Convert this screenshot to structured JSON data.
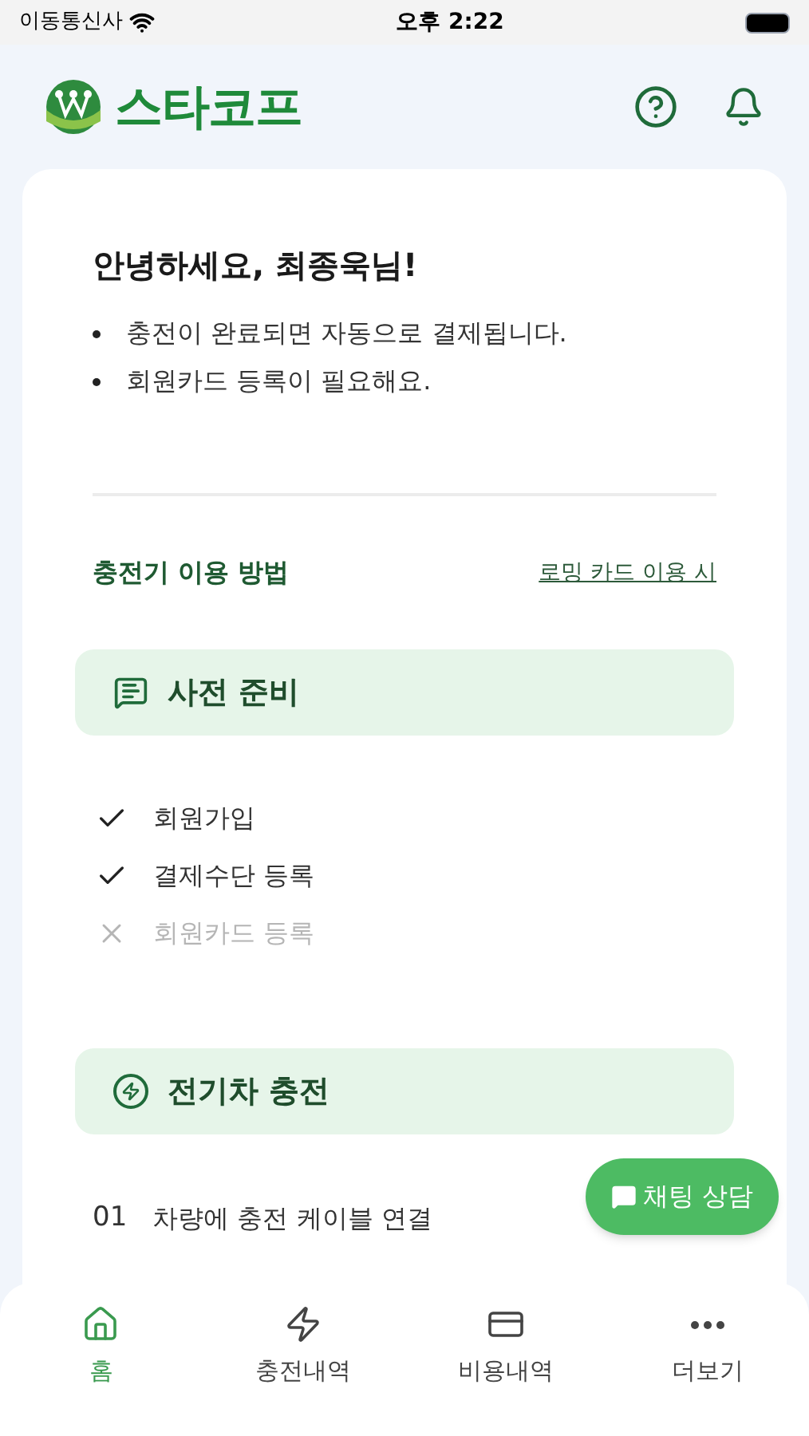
{
  "status_bar": {
    "carrier": "이동통신사",
    "time": "오후 2:22"
  },
  "header": {
    "logo_text": "스타코프"
  },
  "greeting": {
    "title": "안녕하세요, 최종욱님!",
    "notes": [
      "충전이 완료되면 자동으로 결제됩니다.",
      "회원카드 등록이 필요해요."
    ]
  },
  "guide": {
    "title": "충전기 이용 방법",
    "link": "로밍 카드 이용 시"
  },
  "sections": [
    {
      "kind": "checklist",
      "title": "사전 준비",
      "items": [
        {
          "label": "회원가입",
          "done": true
        },
        {
          "label": "결제수단 등록",
          "done": true
        },
        {
          "label": "회원카드 등록",
          "done": false
        }
      ]
    },
    {
      "kind": "steps",
      "title": "전기차 충전",
      "steps": [
        {
          "number": "01",
          "label": "차량에 충전 케이블 연결"
        }
      ]
    }
  ],
  "chat_button": {
    "label": "채팅 상담"
  },
  "nav": [
    {
      "label": "홈",
      "kind": "home",
      "selected": true
    },
    {
      "label": "충전내역",
      "kind": "charging",
      "selected": false
    },
    {
      "label": "비용내역",
      "kind": "billing",
      "selected": false
    },
    {
      "label": "더보기",
      "kind": "more",
      "selected": false
    }
  ]
}
